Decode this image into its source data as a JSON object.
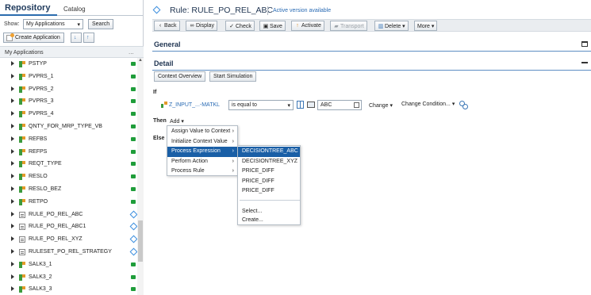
{
  "repo": {
    "tab_repository": "Repository",
    "tab_catalog": "Catalog",
    "show_label": "Show:",
    "show_value": "My Applications",
    "search_label": "Search",
    "create_label": "Create Application",
    "tree_header": "My Applications",
    "header_menu": "...",
    "items": [
      {
        "label": "PSTYP",
        "type": "ctx",
        "status": "green"
      },
      {
        "label": "PVPRS_1",
        "type": "ctx",
        "status": "green"
      },
      {
        "label": "PVPRS_2",
        "type": "ctx",
        "status": "green"
      },
      {
        "label": "PVPRS_3",
        "type": "ctx",
        "status": "green"
      },
      {
        "label": "PVPRS_4",
        "type": "ctx",
        "status": "green"
      },
      {
        "label": "QNTY_FOR_MRP_TYPE_VB",
        "type": "ctx",
        "status": "green"
      },
      {
        "label": "REFBS",
        "type": "ctx",
        "status": "green"
      },
      {
        "label": "REFPS",
        "type": "ctx",
        "status": "green"
      },
      {
        "label": "REQT_TYPE",
        "type": "ctx",
        "status": "green"
      },
      {
        "label": "RESLO",
        "type": "ctx",
        "status": "green"
      },
      {
        "label": "RESLO_BEZ",
        "type": "ctx",
        "status": "green"
      },
      {
        "label": "RETPO",
        "type": "ctx",
        "status": "green"
      },
      {
        "label": "RULE_PO_REL_ABC",
        "type": "rule",
        "status": "diamond"
      },
      {
        "label": "RULE_PO_REL_ABC1",
        "type": "rule",
        "status": "diamond"
      },
      {
        "label": "RULE_PO_REL_XYZ",
        "type": "rule",
        "status": "diamond"
      },
      {
        "label": "RULESET_PO_REL_STRATEGY",
        "type": "rule",
        "status": "diamond"
      },
      {
        "label": "SALK3_1",
        "type": "ctx",
        "status": "green"
      },
      {
        "label": "SALK3_2",
        "type": "ctx",
        "status": "green"
      },
      {
        "label": "SALK3_3",
        "type": "ctx",
        "status": "green"
      }
    ]
  },
  "editor": {
    "title": "Rule: RULE_PO_REL_ABC",
    "version_status": "Active version available",
    "toolbar": {
      "back": "Back",
      "display": "Display",
      "check": "Check",
      "save": "Save",
      "activate": "Activate",
      "transport": "Transport",
      "delete": "Delete",
      "more": "More"
    },
    "general_label": "General",
    "detail_label": "Detail",
    "context_overview": "Context Overview",
    "start_simulation": "Start Simulation",
    "if_label": "If",
    "condition_field": "Z_INPUT_...-MATKL",
    "operator": "is equal to",
    "value": "ABC",
    "change_label": "Change",
    "change_condition_label": "Change Condition...",
    "then_label": "Then",
    "add_label": "Add",
    "else_label": "Else",
    "add_menu": [
      {
        "label": "Assign Value to Context",
        "arrow": true
      },
      {
        "label": "Initialize Context Value",
        "arrow": true
      },
      {
        "label": "Process Expression",
        "arrow": true,
        "highlight": true
      },
      {
        "label": "Perform Action",
        "arrow": true
      },
      {
        "label": "Process Rule",
        "arrow": true
      }
    ],
    "expr_submenu": [
      {
        "label": "DECISIONTREE_ABC",
        "highlight": true
      },
      {
        "label": "DECISIONTREE_XYZ"
      },
      {
        "label": "PRICE_DIFF"
      },
      {
        "label": "PRICE_DIFF"
      },
      {
        "label": "PRICE_DIFF"
      }
    ],
    "expr_select": "Select...",
    "expr_create": "Create..."
  },
  "colors": {
    "status_green": "#1f9d3a",
    "accent_blue": "#2b6cae",
    "menu_highlight": "#1a5fa6"
  }
}
